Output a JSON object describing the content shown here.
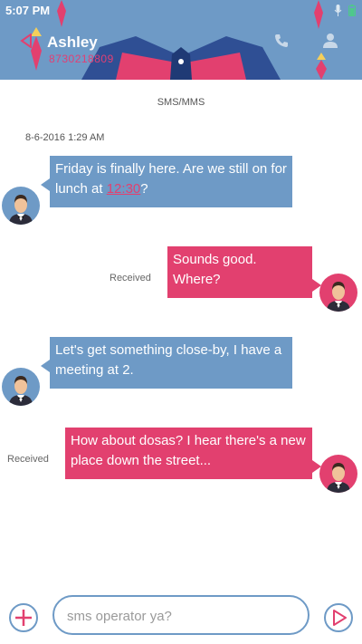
{
  "status_bar": {
    "time": "5:07 PM"
  },
  "header": {
    "contact_name": "Ashley",
    "contact_phone": "8730218809"
  },
  "thread": {
    "channel_label": "SMS/MMS",
    "date": "8-6-2016 1:29 AM",
    "messages": [
      {
        "direction": "incoming",
        "text_before": "Friday is finally here. Are we still on for lunch at ",
        "link": "12:30",
        "text_after": "?"
      },
      {
        "direction": "outgoing",
        "text": "Sounds good. Where?",
        "status": "Received"
      },
      {
        "direction": "incoming",
        "text": "Let's get something close-by, I have a meeting at 2."
      },
      {
        "direction": "outgoing",
        "text": "How about dosas? I hear there's a new place down the street...",
        "status": "Received"
      }
    ]
  },
  "compose": {
    "placeholder": "sms operator ya?"
  },
  "colors": {
    "accent_blue": "#6e9ac6",
    "accent_pink": "#e2406f"
  },
  "icons": [
    "back-icon",
    "phone-icon",
    "contact-icon",
    "mic-icon",
    "battery-icon",
    "plus-icon",
    "send-icon"
  ]
}
